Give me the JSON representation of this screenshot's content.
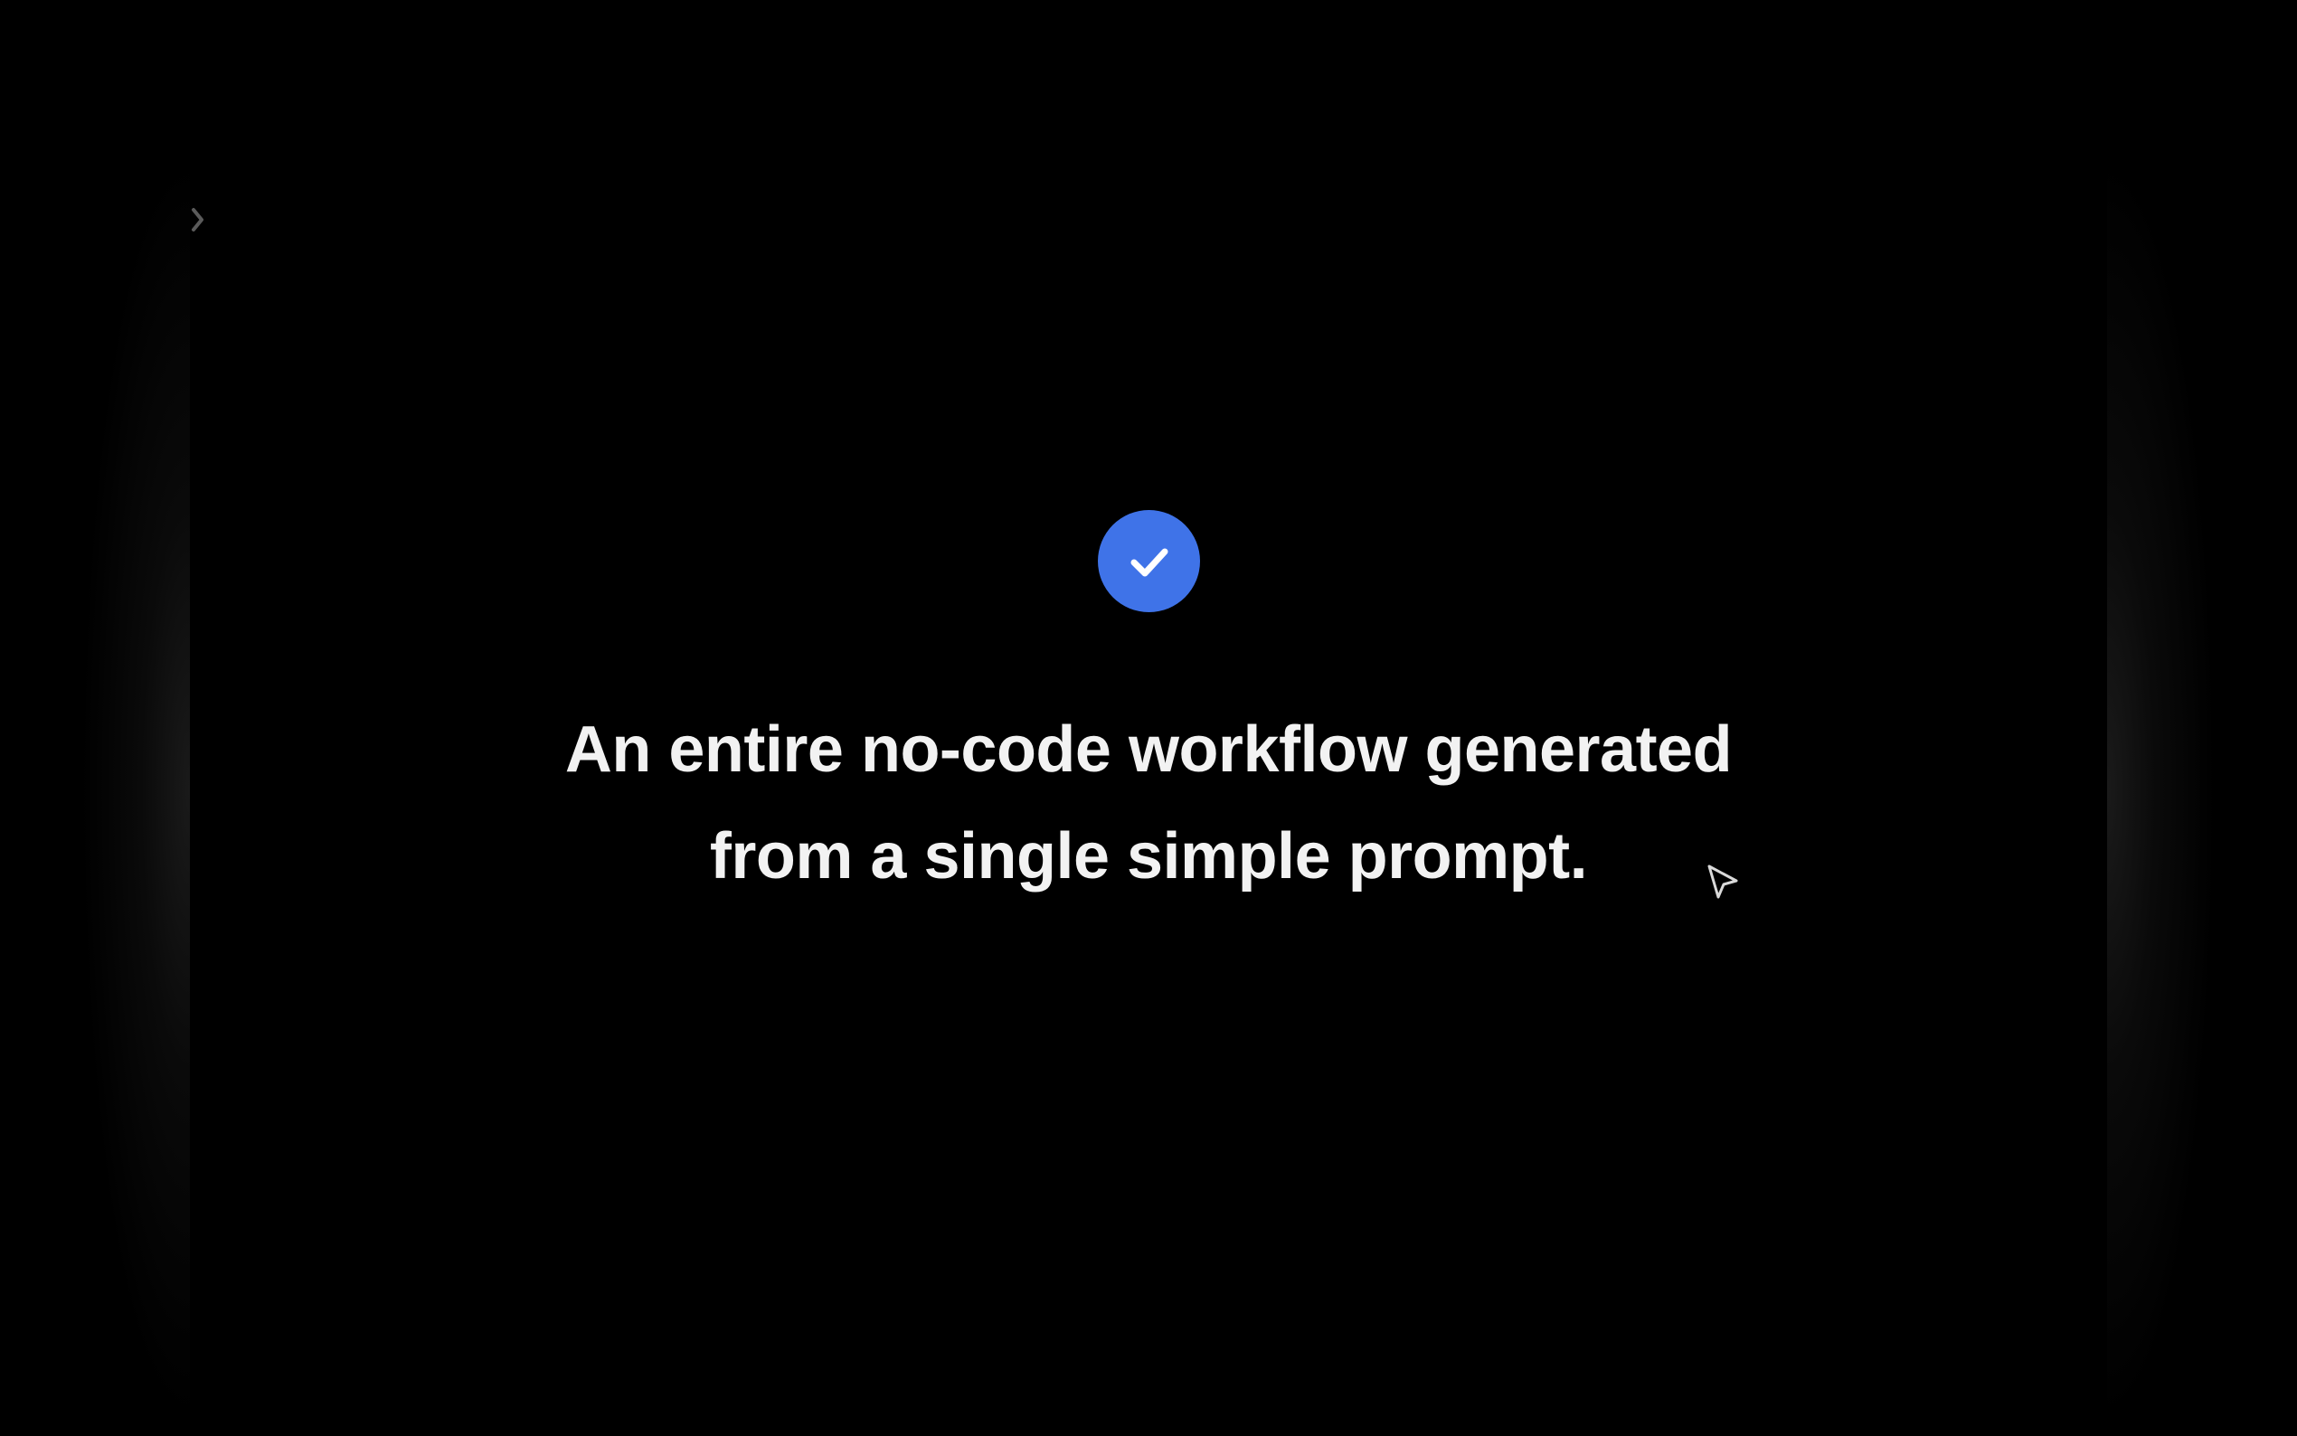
{
  "screen": {
    "background_color": "#000000"
  },
  "sidebar_toggle": {
    "icon": "chevron-right-icon",
    "color": "#5a5a5a"
  },
  "success": {
    "icon": "check-icon",
    "circle_color": "#3f73e8",
    "check_color": "#ffffff"
  },
  "headline": {
    "line1": "An entire no-code workflow generated",
    "line2": "from a single simple prompt.",
    "color": "#f2f2f2"
  },
  "cursor": {
    "icon": "pointer-cursor-icon"
  }
}
